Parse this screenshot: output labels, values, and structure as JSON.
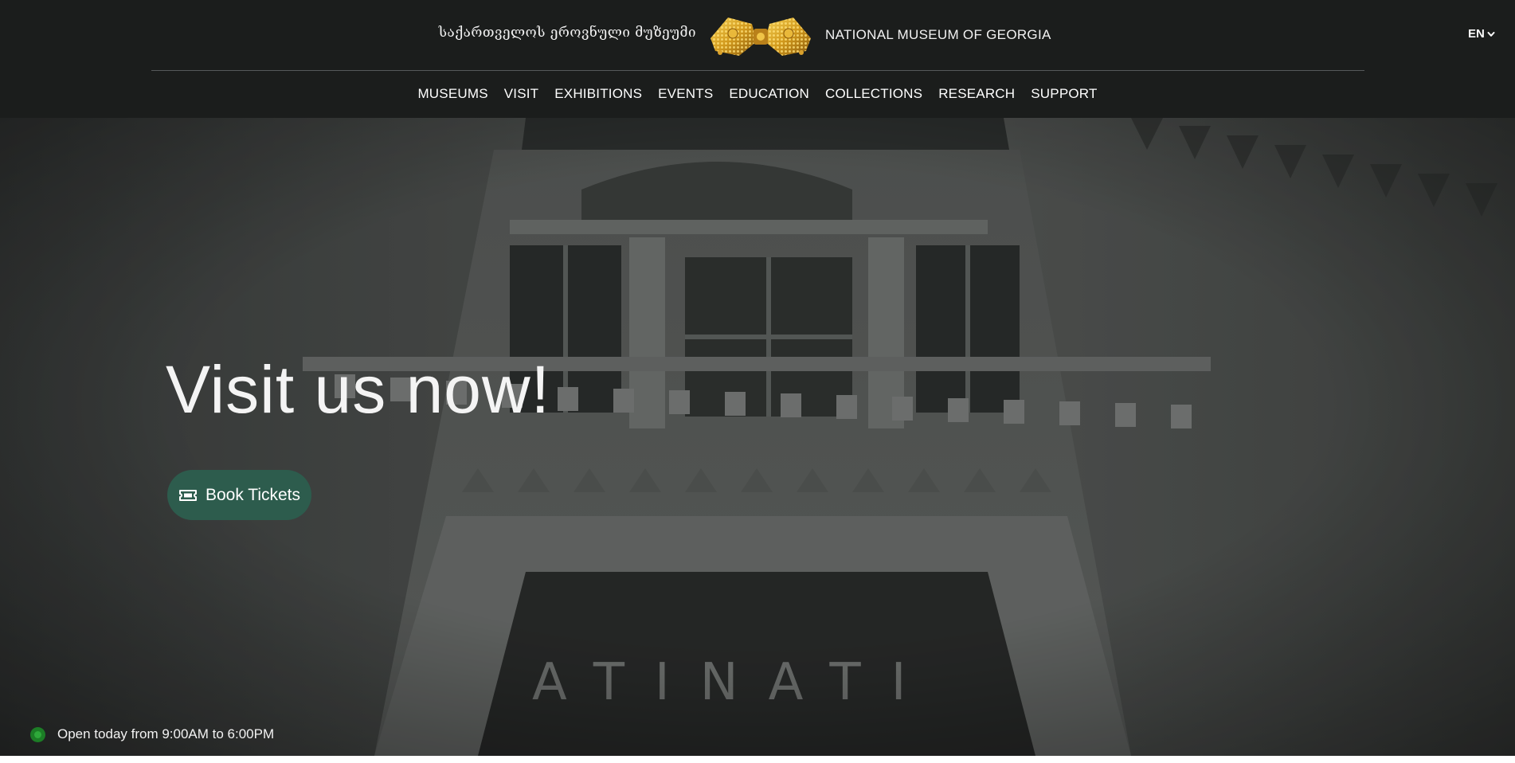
{
  "header": {
    "title_ka": "საქართველოს ეროვნული მუზეუმი",
    "title_en": "NATIONAL MUSEUM OF GEORGIA",
    "logo_icon": "golden-ornament-logo",
    "language": {
      "label": "EN",
      "icon": "chevron-down-icon"
    }
  },
  "nav": {
    "items": [
      {
        "label": "MUSEUMS"
      },
      {
        "label": "VISIT"
      },
      {
        "label": "EXHIBITIONS"
      },
      {
        "label": "EVENTS"
      },
      {
        "label": "EDUCATION"
      },
      {
        "label": "COLLECTIONS"
      },
      {
        "label": "RESEARCH"
      },
      {
        "label": "SUPPORT"
      }
    ]
  },
  "hero": {
    "headline": "Visit us now!",
    "cta": {
      "label": "Book Tickets",
      "icon": "ticket-icon"
    },
    "background_sign": "ATINATI"
  },
  "status": {
    "text": "Open today from 9:00AM to 6:00PM",
    "indicator": "open"
  },
  "colors": {
    "header_bg": "#1b1d1c",
    "button_bg": "#2d5c4d",
    "status_green": "#2ea83a"
  }
}
